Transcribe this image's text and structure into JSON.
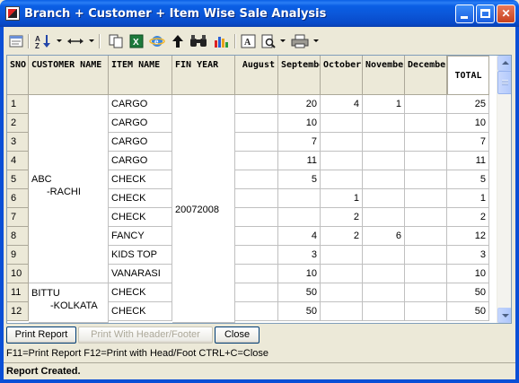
{
  "window": {
    "title": "Branch + Customer + Item Wise Sale Analysis",
    "controls": [
      "minimize",
      "maximize",
      "close"
    ]
  },
  "toolbar": {
    "icons": [
      "report-icon",
      "sort-icon",
      "column-width-icon",
      "copy-icon",
      "excel-icon",
      "internet-icon",
      "up-arrow-icon",
      "find-icon",
      "chart-icon",
      "font-icon",
      "print-preview-icon",
      "print-icon"
    ]
  },
  "grid": {
    "headers": {
      "sno": "SNO.",
      "customer": "CUSTOMER NAME",
      "item": "ITEM NAME",
      "finyear": "FIN YEAR",
      "august": "August",
      "september": "September",
      "october": "October",
      "november": "November",
      "december": "December",
      "total": "TOTAL"
    },
    "customers": [
      {
        "name": "ABC",
        "branch": "-RACHI"
      },
      {
        "name": "BITTU",
        "branch": "-KOLKATA"
      }
    ],
    "fin_year": "20072008",
    "rows": [
      {
        "sno": "1",
        "item": "CARGO",
        "august": "",
        "september": "20",
        "october": "4",
        "november": "1",
        "december": "",
        "total": "25"
      },
      {
        "sno": "2",
        "item": "CARGO",
        "august": "",
        "september": "10",
        "october": "",
        "november": "",
        "december": "",
        "total": "10"
      },
      {
        "sno": "3",
        "item": "CARGO",
        "august": "",
        "september": "7",
        "october": "",
        "november": "",
        "december": "",
        "total": "7"
      },
      {
        "sno": "4",
        "item": "CARGO",
        "august": "",
        "september": "11",
        "october": "",
        "november": "",
        "december": "",
        "total": "11"
      },
      {
        "sno": "5",
        "item": "CHECK",
        "august": "",
        "september": "5",
        "october": "",
        "november": "",
        "december": "",
        "total": "5"
      },
      {
        "sno": "6",
        "item": "CHECK",
        "august": "",
        "september": "",
        "october": "1",
        "november": "",
        "december": "",
        "total": "1"
      },
      {
        "sno": "7",
        "item": "CHECK",
        "august": "",
        "september": "",
        "october": "2",
        "november": "",
        "december": "",
        "total": "2"
      },
      {
        "sno": "8",
        "item": "FANCY",
        "august": "",
        "september": "4",
        "october": "2",
        "november": "6",
        "december": "",
        "total": "12"
      },
      {
        "sno": "9",
        "item": "KIDS TOP",
        "august": "",
        "september": "3",
        "october": "",
        "november": "",
        "december": "",
        "total": "3"
      },
      {
        "sno": "10",
        "item": "VANARASI",
        "august": "",
        "september": "10",
        "october": "",
        "november": "",
        "december": "",
        "total": "10"
      },
      {
        "sno": "11",
        "item": "CHECK",
        "august": "",
        "september": "50",
        "october": "",
        "november": "",
        "december": "",
        "total": "50"
      },
      {
        "sno": "12",
        "item": "CHECK",
        "august": "",
        "september": "50",
        "october": "",
        "november": "",
        "december": "",
        "total": "50"
      }
    ]
  },
  "buttons": {
    "print_report": "Print Report",
    "print_header_footer": "Print With Header/Footer",
    "close": "Close"
  },
  "hint": "F11=Print Report  F12=Print with Head/Foot  CTRL+C=Close",
  "status": "Report Created."
}
